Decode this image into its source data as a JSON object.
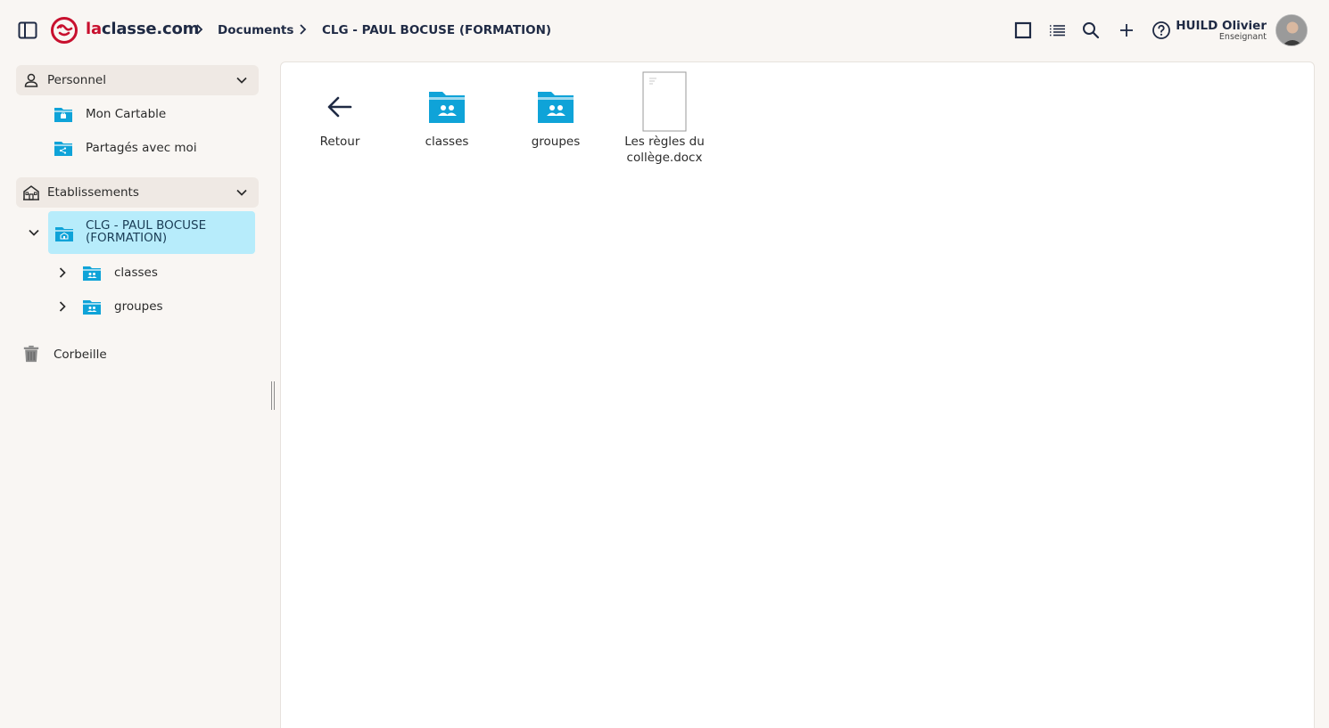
{
  "header": {
    "brand_prefix": "la",
    "brand_suffix": "classe.com",
    "breadcrumb": [
      "Documents",
      "CLG - PAUL BOCUSE (FORMATION)"
    ],
    "user": {
      "name": "HUILD Olivier",
      "role": "Enseignant"
    },
    "icons": [
      "sidebar-toggle-icon",
      "square-view-icon",
      "list-view-icon",
      "search-icon",
      "plus-icon",
      "help-icon"
    ]
  },
  "sidebar": {
    "personnel": {
      "label": "Personnel",
      "items": [
        {
          "label": "Mon Cartable",
          "icon": "briefcase-folder-icon"
        },
        {
          "label": "Partagés avec moi",
          "icon": "shared-folder-icon"
        }
      ]
    },
    "etablissements": {
      "label": "Etablissements",
      "school": "CLG - PAUL BOCUSE (FORMATION)",
      "children": [
        {
          "label": "classes",
          "icon": "group-folder-icon"
        },
        {
          "label": "groupes",
          "icon": "group-folder-icon"
        }
      ]
    },
    "trash": "Corbeille"
  },
  "main": {
    "tiles": [
      {
        "label": "Retour",
        "icon": "back-arrow-icon"
      },
      {
        "label": "classes",
        "icon": "group-folder-icon"
      },
      {
        "label": "groupes",
        "icon": "group-folder-icon"
      },
      {
        "label": "Les règles du collège.docx",
        "icon": "document-icon"
      }
    ]
  },
  "colors": {
    "brand_red": "#c8102e",
    "navy": "#1f2a44",
    "folder_blue": "#0fa3d8",
    "active_bg": "#b7ecfb",
    "section_bg": "#efe9e4",
    "page_bg": "#f9f6f3"
  }
}
